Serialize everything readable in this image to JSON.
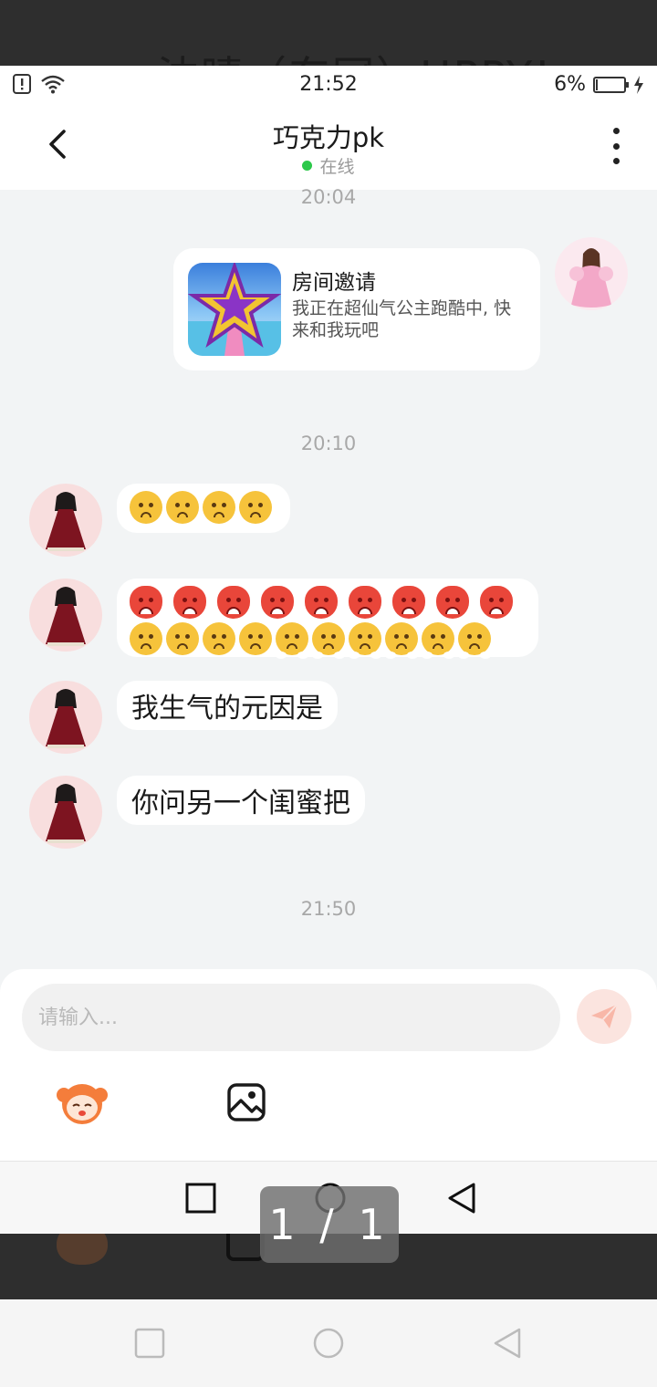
{
  "viewer": {
    "ghost_title": "沈晴（东冠）HPPY!",
    "page_indicator": "1 / 1"
  },
  "statusbar": {
    "time": "21:52",
    "battery": "6%",
    "battery_level": 0.06
  },
  "header": {
    "title": "巧克力pk",
    "status": "在线",
    "status_color": "#2cc84a"
  },
  "messages": {
    "ts1": "20:04",
    "invite": {
      "title": "房间邀请",
      "desc": "我正在超仙气公主跑酷中, 快来和我玩吧"
    },
    "ts2": "20:10",
    "emoji1": [
      "sad-face",
      "sad-face",
      "sad-face",
      "sad-face"
    ],
    "emoji2_row1": [
      "rage-face",
      "rage-face",
      "rage-face",
      "rage-face",
      "rage-face",
      "rage-face",
      "rage-face",
      "rage-face",
      "rage-face"
    ],
    "emoji2_row2": [
      "sad-face",
      "sad-face",
      "sad-face",
      "sad-face",
      "huff-face",
      "huff-face",
      "huff-face",
      "huff-face",
      "huff-face",
      "huff-face"
    ],
    "text1": "我生气的元因是",
    "text2": "你问另一个闺蜜把",
    "ts3": "21:50"
  },
  "input": {
    "placeholder": "请输入...",
    "send_color": "#fbe4df"
  }
}
